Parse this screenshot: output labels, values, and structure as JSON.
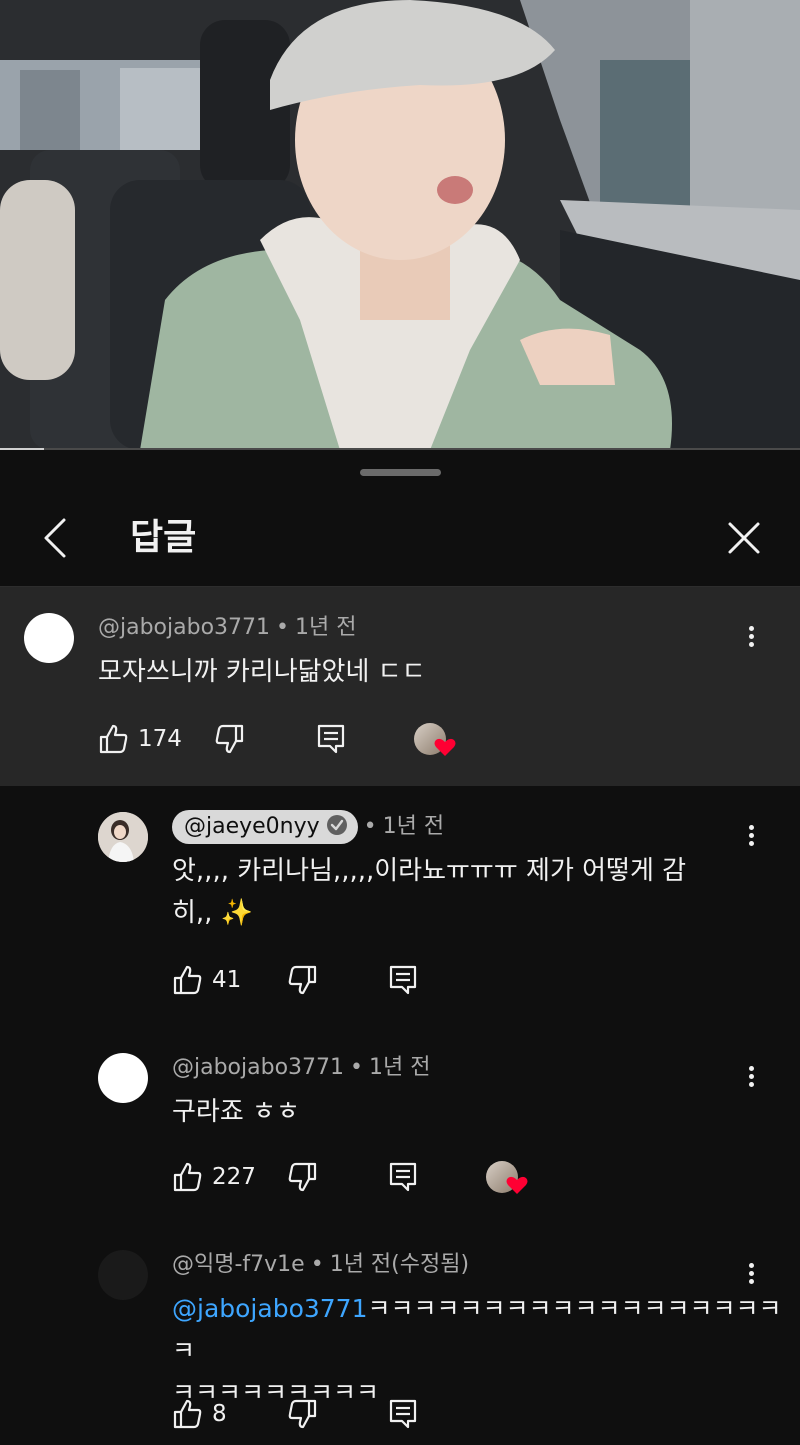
{
  "video": {
    "progress_fraction": 0.055
  },
  "panel": {
    "title": "답글"
  },
  "parent": {
    "author": "@jabojabo3771",
    "time": "1년 전",
    "text": "모자쓰니까 카리나닮았네 ㄷㄷ",
    "likes": "174",
    "creator_heart": true
  },
  "replies": [
    {
      "author": "@jaeye0nyy",
      "author_is_creator": true,
      "time": "1년 전",
      "text_line1": "앗,,,, 카리나님,,,,,이라뇨ㅠㅠㅠ 제가 어떻게 감",
      "text_line2": "히,, ✨",
      "likes": "41",
      "creator_heart": false
    },
    {
      "author": "@jabojabo3771",
      "author_is_creator": false,
      "time": "1년 전",
      "text_line1": "구라죠 ㅎㅎ",
      "likes": "227",
      "creator_heart": true
    },
    {
      "author": "@익명-f7v1e",
      "author_is_creator": false,
      "time": "1년 전(수정됨)",
      "mention": "@jabojabo3771",
      "text_line1": "ㅋㅋㅋㅋㅋㅋㅋㅋㅋㅋㅋㅋㅋㅋㅋㅋㅋㅋㅋ",
      "text_line2": "ㅋㅋㅋㅋㅋㅋㅋㅋㅋ",
      "likes": "8",
      "creator_heart": false
    }
  ],
  "icons": {
    "back": "chevron-left-icon",
    "close": "close-icon",
    "like": "thumbs-up-icon",
    "dislike": "thumbs-down-icon",
    "reply": "reply-comment-icon",
    "more": "more-vertical-icon",
    "heart": "creator-heart-icon"
  },
  "colors": {
    "background": "#0f0f0f",
    "highlight_bg": "#272727",
    "mention": "#3ea6ff",
    "heart": "#ff0033",
    "chip": "#d9d9d9"
  }
}
